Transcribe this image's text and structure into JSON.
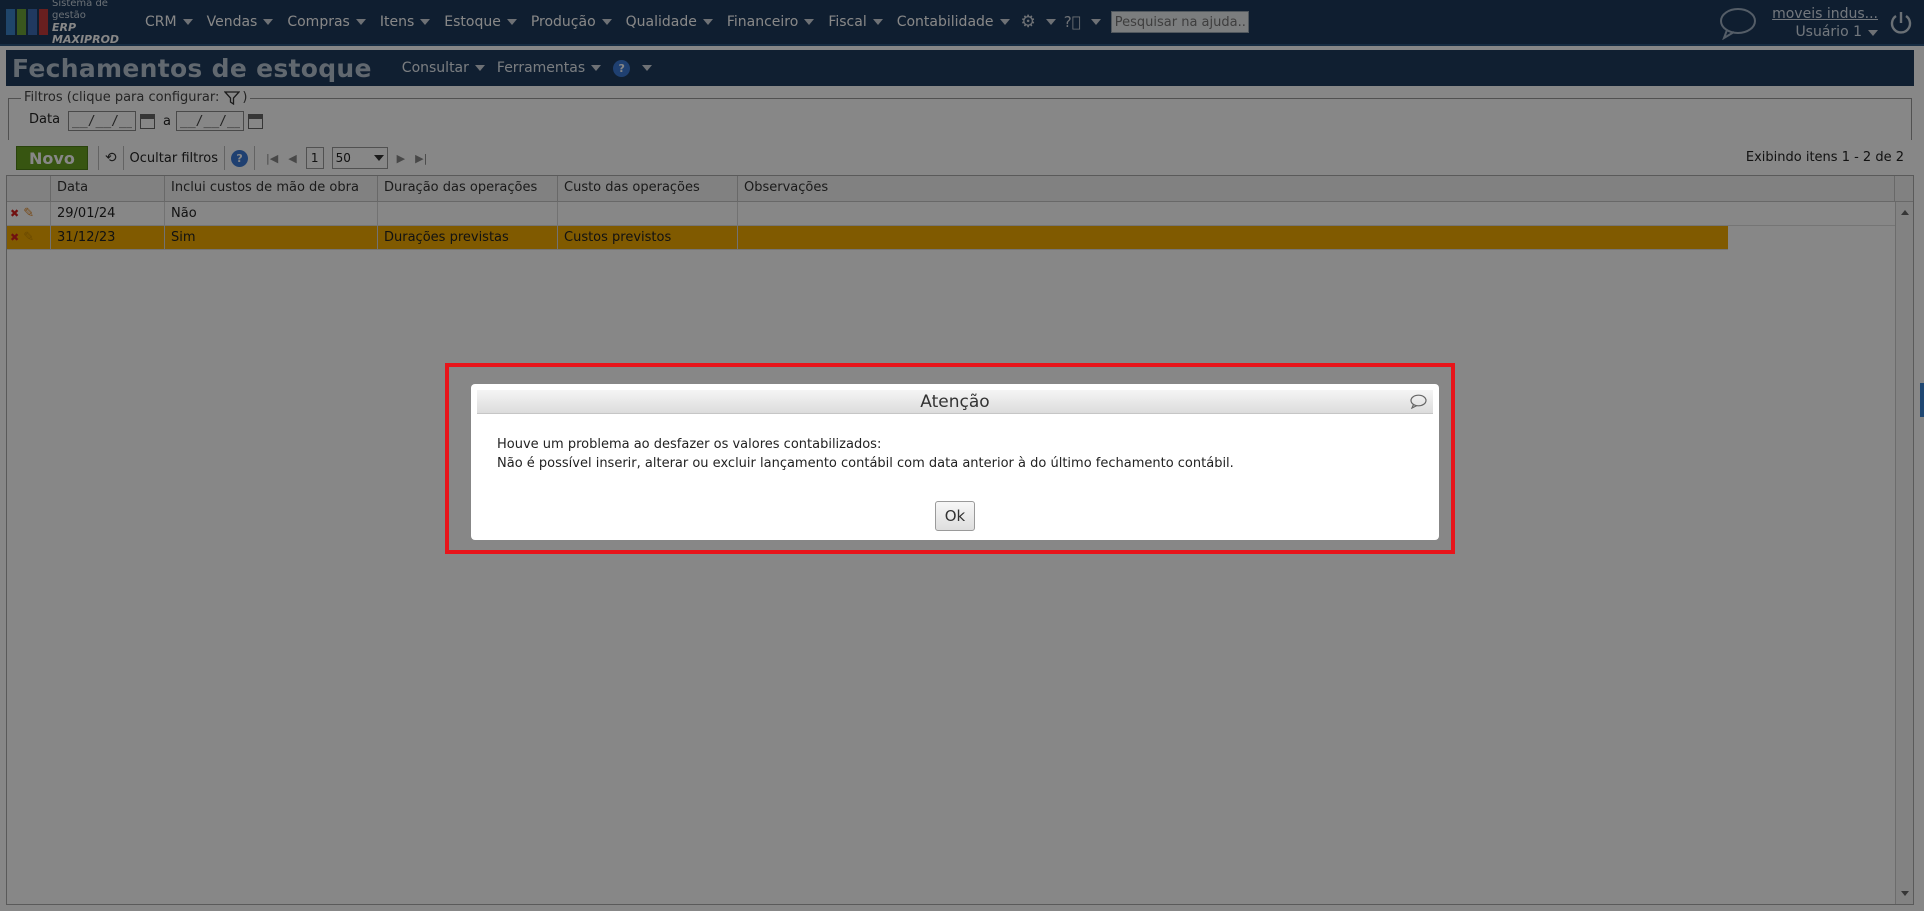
{
  "topbar": {
    "logo_line1": "Sistema de gestão",
    "logo_line2": "ERP MAXIPROD",
    "menu": [
      {
        "label": "CRM"
      },
      {
        "label": "Vendas"
      },
      {
        "label": "Compras"
      },
      {
        "label": "Itens"
      },
      {
        "label": "Estoque"
      },
      {
        "label": "Produção"
      },
      {
        "label": "Qualidade"
      },
      {
        "label": "Financeiro"
      },
      {
        "label": "Fiscal"
      },
      {
        "label": "Contabilidade"
      }
    ],
    "search_placeholder": "Pesquisar na ajuda...",
    "company": "moveis indus...",
    "user": "Usuário 1"
  },
  "page": {
    "title": "Fechamentos de estoque",
    "menu_consultar": "Consultar",
    "menu_ferramentas": "Ferramentas"
  },
  "filters": {
    "legend": "Filtros (clique para configurar:",
    "legend_end": ")",
    "date_label": "Data",
    "separator": "a",
    "date_from": "__/__/__",
    "date_to": "__/__/__"
  },
  "toolbar": {
    "new_label": "Novo",
    "hide_filters": "Ocultar filtros",
    "page": "1",
    "page_size": "50",
    "items_info": "Exibindo itens 1 - 2 de 2"
  },
  "grid": {
    "columns": [
      "Data",
      "Inclui custos de mão de obra",
      "Duração das operações",
      "Custo das operações",
      "Observações"
    ],
    "rows": [
      {
        "data": "29/01/24",
        "inclui": "Não",
        "duracao": "",
        "custo": "",
        "obs": ""
      },
      {
        "data": "31/12/23",
        "inclui": "Sim",
        "duracao": "Durações previstas",
        "custo": "Custos previstos",
        "obs": ""
      }
    ]
  },
  "dialog": {
    "title": "Atenção",
    "message_line1": "Houve um problema ao desfazer os valores contabilizados:",
    "message_line2": "Não é possível inserir, alterar ou excluir lançamento contábil com data anterior à do último fechamento contábil.",
    "ok_label": "Ok"
  },
  "colors": {
    "topbar": "#1e3a5c",
    "selected_row": "#f2ab00",
    "new_button": "#68a121",
    "highlight": "#e8141a"
  }
}
